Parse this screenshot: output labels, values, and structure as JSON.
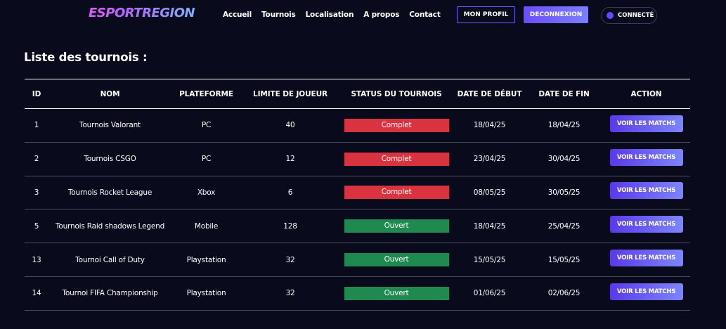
{
  "brand": {
    "logo_text": "ESPORTREGION"
  },
  "nav": {
    "links": [
      "Accueil",
      "Tournois",
      "Localisation",
      "A propos",
      "Contact"
    ],
    "profile_label": "MON PROFIL",
    "logout_label": "DECONNEXION",
    "status_label": "CONNECTÉ"
  },
  "page": {
    "title": "Liste des tournois :"
  },
  "table": {
    "headers": [
      "ID",
      "NOM",
      "PLATEFORME",
      "LIMITE DE JOUEUR",
      "STATUS DU TOURNOIS",
      "DATE DE DÉBUT",
      "DATE DE FIN",
      "ACTION"
    ],
    "action_label": "VOIR LES MATCHS",
    "rows": [
      {
        "id": "1",
        "nom": "Tournois Valorant",
        "plateforme": "PC",
        "limite": "40",
        "status": "Complet",
        "debut": "18/04/25",
        "fin": "18/04/25"
      },
      {
        "id": "2",
        "nom": "Tournois CSGO",
        "plateforme": "PC",
        "limite": "12",
        "status": "Complet",
        "debut": "23/04/25",
        "fin": "30/04/25"
      },
      {
        "id": "3",
        "nom": "Tournois Rocket League",
        "plateforme": "Xbox",
        "limite": "6",
        "status": "Complet",
        "debut": "08/05/25",
        "fin": "30/05/25"
      },
      {
        "id": "5",
        "nom": "Tournois Raid shadows Legend",
        "plateforme": "Mobile",
        "limite": "128",
        "status": "Ouvert",
        "debut": "18/04/25",
        "fin": "25/04/25"
      },
      {
        "id": "13",
        "nom": "Tournoi Call of Duty",
        "plateforme": "Playstation",
        "limite": "32",
        "status": "Ouvert",
        "debut": "15/05/25",
        "fin": "15/05/25"
      },
      {
        "id": "14",
        "nom": "Tournoi FIFA Championship",
        "plateforme": "Playstation",
        "limite": "32",
        "status": "Ouvert",
        "debut": "01/06/25",
        "fin": "02/06/25"
      }
    ]
  },
  "colors": {
    "background": "#090a1c",
    "accent": "#6a4cff",
    "status_complet": "#d9333f",
    "status_ouvert": "#1e8a4f"
  }
}
